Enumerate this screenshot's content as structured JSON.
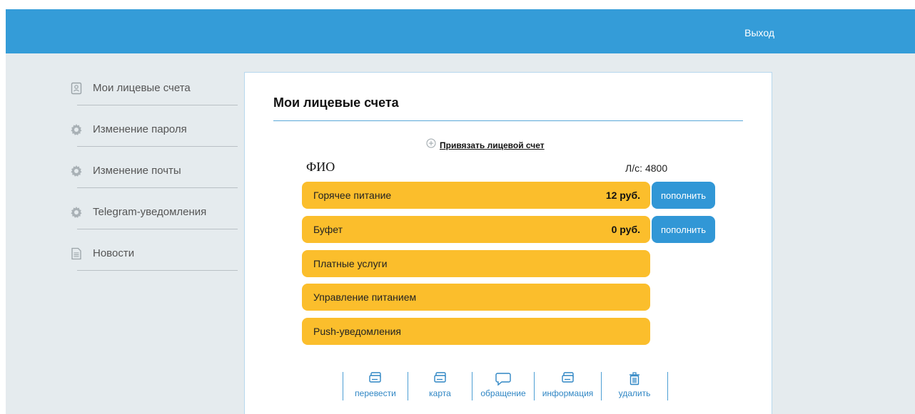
{
  "header": {
    "logout_label": "Выход"
  },
  "sidebar": {
    "items": [
      {
        "label": "Мои лицевые счета",
        "icon": "account-card-icon"
      },
      {
        "label": "Изменение пароля",
        "icon": "gear-icon"
      },
      {
        "label": "Изменение почты",
        "icon": "gear-icon"
      },
      {
        "label": "Telegram-уведомления",
        "icon": "gear-icon"
      },
      {
        "label": "Новости",
        "icon": "document-icon"
      }
    ]
  },
  "main": {
    "title": "Мои лицевые счета",
    "bind_account_label": "Привязать лицевой счет",
    "account": {
      "fio": "ФИО",
      "ls_label": "Л/с:",
      "ls_number": "4800"
    },
    "services": [
      {
        "label": "Горячее питание",
        "amount": "12 руб.",
        "action": "пополнить"
      },
      {
        "label": "Буфет",
        "amount": "0 руб.",
        "action": "пополнить"
      },
      {
        "label": "Платные услуги"
      },
      {
        "label": "Управление питанием"
      },
      {
        "label": "Push-уведомления"
      }
    ],
    "toolbar": [
      {
        "label": "перевести",
        "icon": "transfer-icon"
      },
      {
        "label": "карта",
        "icon": "card-icon"
      },
      {
        "label": "обращение",
        "icon": "chat-icon"
      },
      {
        "label": "информация",
        "icon": "info-icon"
      },
      {
        "label": "удалить",
        "icon": "trash-icon"
      }
    ]
  },
  "colors": {
    "header_blue": "#349cd8",
    "service_yellow": "#fbbe2c",
    "button_blue": "#3197d6",
    "page_gray": "#e5ebee"
  }
}
